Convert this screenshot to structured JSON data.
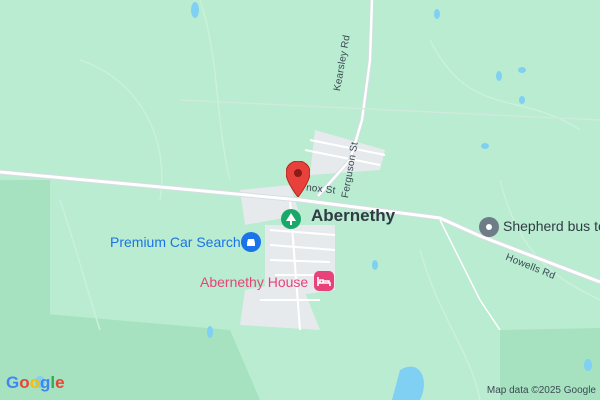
{
  "map": {
    "places": {
      "town": "Abernethy",
      "abernethy_house": "Abernethy House",
      "premium_car_search": "Premium Car Search",
      "shepherd_bus": "Shepherd bus to"
    },
    "roads": {
      "kearsley_rd": "Kearsley Rd",
      "ferguson_st": "Ferguson St",
      "knox_st": "nox St",
      "howells_rd": "Howells Rd"
    },
    "attribution": "Map data ©2025 Google",
    "logo": "Google"
  },
  "colors": {
    "land": "#b9ecd0",
    "dark_green": "#9fdcb5",
    "road": "#ffffff",
    "water": "#7fd0f2",
    "pin": "#e8403a",
    "poi_green": "#1aa76a",
    "poi_blue": "#1a73e8",
    "poi_pink": "#e8427a",
    "poi_grey": "#6e7c87"
  },
  "icons": {
    "pin": "location-pin-icon",
    "town": "tree-icon",
    "car": "car-icon",
    "hotel": "bed-icon",
    "bus": "bus-stop-icon"
  }
}
